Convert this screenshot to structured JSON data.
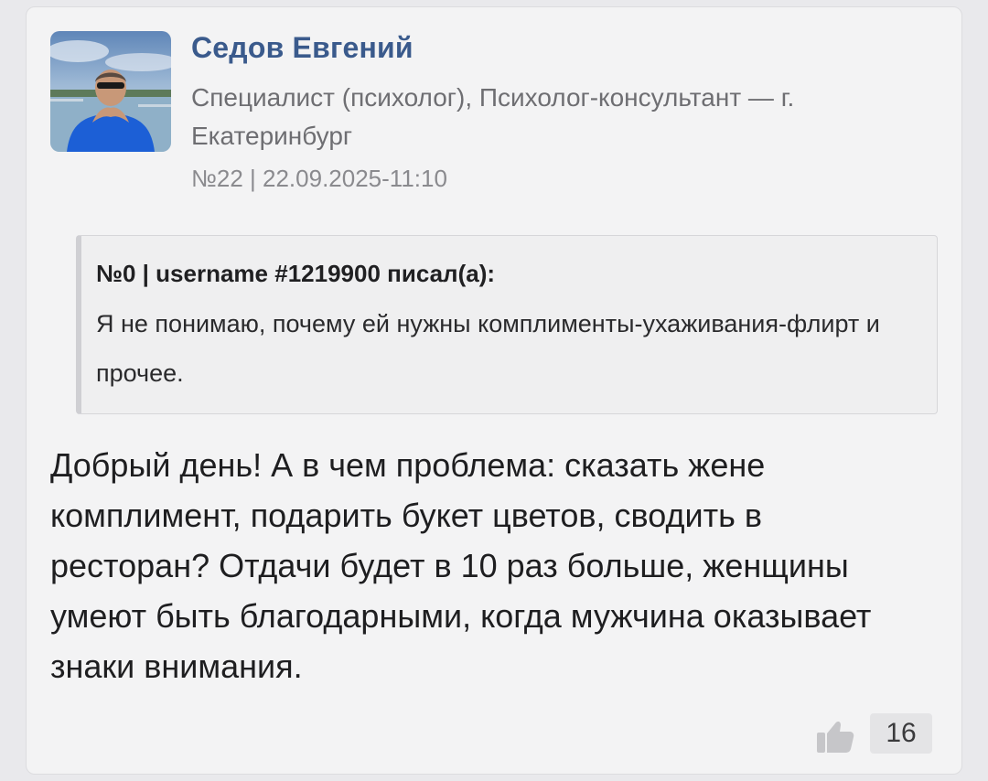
{
  "post": {
    "author": {
      "name": "Седов Евгений",
      "role": "Специалист (психолог), Психолог-консультант — г. Екатеринбург"
    },
    "meta": "№22 | 22.09.2025-11:10",
    "quote": {
      "header": "№0 | username #1219900 писал(а):",
      "text": "Я не понимаю, почему ей нужны комплименты-ухаживания-флирт и прочее."
    },
    "body": "Добрый день! А в чем проблема: сказать жене комплимент, подарить букет цветов, сводить в ресторан? Отдачи будет в 10 раз больше, женщины умеют быть благодарными, когда мужчина оказывает знаки внимания.",
    "likes": {
      "icon": "thumbs-up-icon",
      "count": "16"
    }
  },
  "colors": {
    "author_name": "#3a5a8c",
    "card_background": "#f3f3f4",
    "quote_background": "#efeff0"
  }
}
